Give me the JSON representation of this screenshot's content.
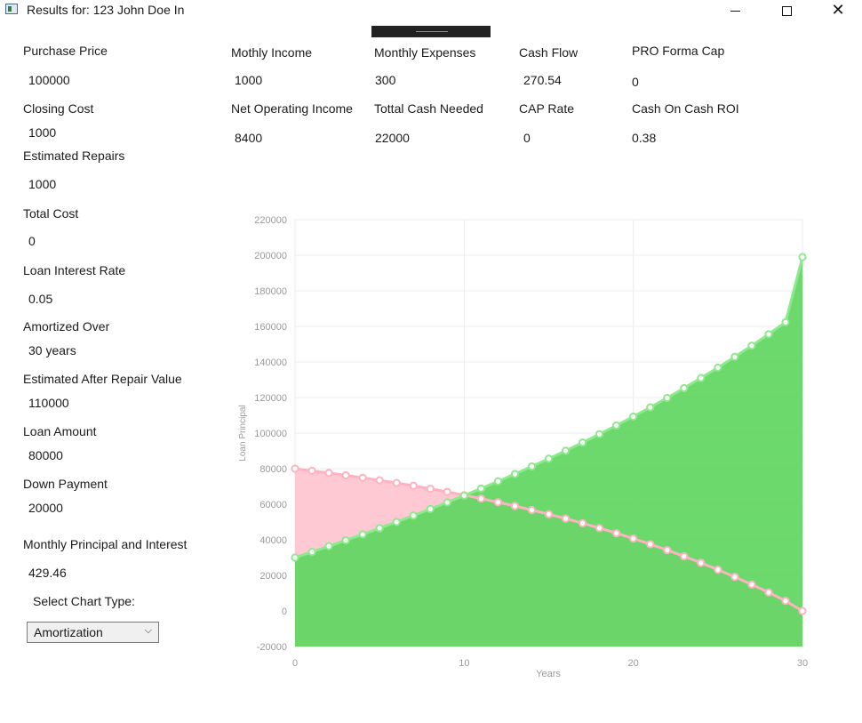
{
  "window": {
    "title": "Results for: 123 John Doe In"
  },
  "left_fields": [
    {
      "label": "Purchase Price",
      "value": "100000"
    },
    {
      "label": "Closing Cost",
      "value": "1000"
    },
    {
      "label": "Estimated Repairs",
      "value": "1000"
    },
    {
      "label": "Total Cost",
      "value": "0"
    },
    {
      "label": "Loan Interest Rate",
      "value": "0.05"
    },
    {
      "label": "Amortized Over",
      "value": "30 years"
    },
    {
      "label": "Estimated After Repair Value",
      "value": "110000"
    },
    {
      "label": "Loan Amount",
      "value": "80000"
    },
    {
      "label": "Down Payment",
      "value": "20000"
    },
    {
      "label": "Monthly Principal and Interest",
      "value": "429.46"
    }
  ],
  "top_fields": [
    {
      "label": "Mothly Income",
      "value": "1000"
    },
    {
      "label": "Monthly Expenses",
      "value": "300"
    },
    {
      "label": "Cash Flow",
      "value": "270.54"
    },
    {
      "label": "PRO Forma Cap",
      "value": "0"
    },
    {
      "label": "Net Operating Income",
      "value": "8400"
    },
    {
      "label": "Tottal Cash Needed",
      "value": "22000"
    },
    {
      "label": "CAP Rate",
      "value": "0"
    },
    {
      "label": "Cash On Cash ROI",
      "value": "0.38"
    }
  ],
  "chart_select": {
    "label": "Select Chart Type:",
    "value": "Amortization"
  },
  "colors": {
    "principal_fill": "#ffc9d3",
    "principal_line": "#ffb3c1",
    "equity_fill": "#5fd65f",
    "equity_line": "#8ee88e"
  },
  "chart_data": {
    "type": "area",
    "xlabel": "Years",
    "ylabel": "Loan Principal",
    "xlim": [
      0,
      30
    ],
    "ylim": [
      -20000,
      220000
    ],
    "x_ticks": [
      0,
      10,
      20,
      30
    ],
    "y_ticks": [
      -20000,
      0,
      20000,
      40000,
      60000,
      80000,
      100000,
      120000,
      140000,
      160000,
      180000,
      200000,
      220000
    ],
    "x": [
      0,
      1,
      2,
      3,
      4,
      5,
      6,
      7,
      8,
      9,
      10,
      11,
      12,
      13,
      14,
      15,
      16,
      17,
      18,
      19,
      20,
      21,
      22,
      23,
      24,
      25,
      26,
      27,
      28,
      29,
      30
    ],
    "series": [
      {
        "values": [
          80000,
          78820,
          77580,
          76280,
          74910,
          73470,
          71960,
          70370,
          68700,
          66940,
          65100,
          63160,
          61130,
          58990,
          56750,
          54390,
          51920,
          49320,
          46590,
          43720,
          40710,
          37540,
          34220,
          30720,
          27050,
          23190,
          19140,
          14880,
          10400,
          5700,
          0
        ]
      },
      {
        "values": [
          30000,
          33180,
          36420,
          39720,
          43090,
          46530,
          50040,
          53630,
          57300,
          61060,
          64900,
          68840,
          72870,
          77010,
          81250,
          85610,
          90080,
          94680,
          99410,
          104280,
          109290,
          114460,
          119780,
          125280,
          130950,
          136810,
          142860,
          149120,
          155600,
          162300,
          199000
        ]
      }
    ]
  }
}
